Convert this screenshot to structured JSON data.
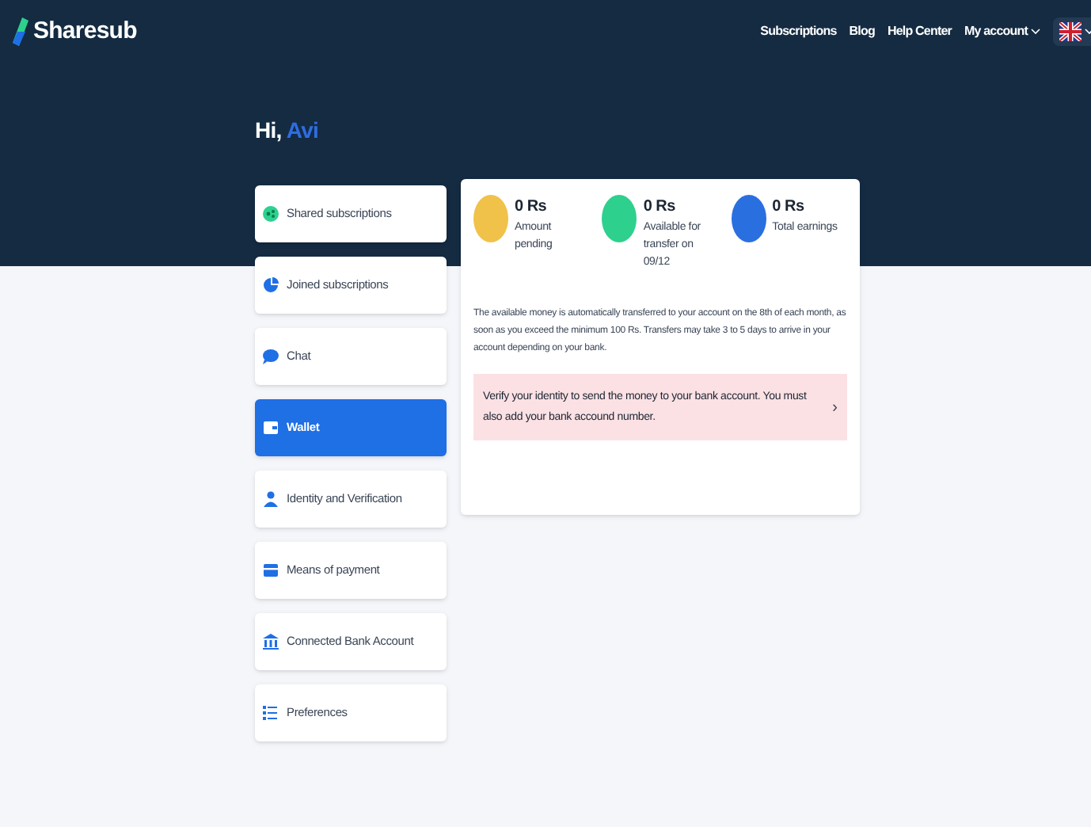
{
  "header": {
    "logo": "Sharesub",
    "nav": [
      {
        "label": "Subscriptions",
        "kind": "link"
      },
      {
        "label": "Blog",
        "kind": "link"
      },
      {
        "label": "Help Center",
        "kind": "link"
      },
      {
        "label": "My account",
        "kind": "dropdown"
      }
    ]
  },
  "greeting": {
    "prefix": "Hi,",
    "name": "Avi"
  },
  "sidebar": {
    "items": [
      {
        "label": "Shared subscriptions",
        "kind": "share",
        "selected": false
      },
      {
        "label": "Joined subscriptions",
        "kind": "pie",
        "selected": false
      },
      {
        "label": "Chat",
        "kind": "chat",
        "selected": false
      },
      {
        "label": "Wallet",
        "kind": "wallet",
        "selected": true
      },
      {
        "label": "Identity and Verification",
        "kind": "user",
        "selected": false
      },
      {
        "label": "Means of payment",
        "kind": "card",
        "selected": false
      },
      {
        "label": "Connected Bank Account",
        "kind": "bank",
        "selected": false
      },
      {
        "label": "Preferences",
        "kind": "prefs",
        "selected": false
      }
    ]
  },
  "wallet": {
    "stats": [
      {
        "amount": "0 Rs",
        "label": "Amount pending",
        "color": "#f0c24a"
      },
      {
        "amount": "0 Rs",
        "label": "Available for transfer on 09/12",
        "color": "#2ed08e"
      },
      {
        "amount": "0 Rs",
        "label": "Total earnings",
        "color": "#2a6fe0"
      }
    ],
    "info": "The available money is automatically transferred to your account on the 8th of each month, as soon as you exceed the minimum 100 Rs. Transfers may take 3 to 5 days to arrive in your account depending on your bank.",
    "alert": {
      "text": "Verify your identity to send the money to your bank account. You must also add your bank accound number.",
      "arrow": "›"
    }
  }
}
